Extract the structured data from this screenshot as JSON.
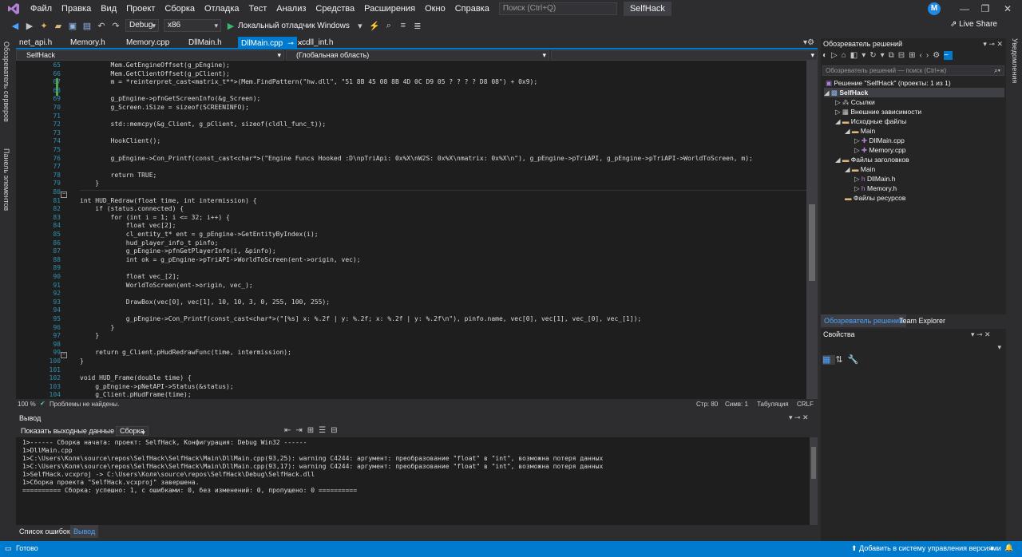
{
  "menu": {
    "items": [
      "Файл",
      "Правка",
      "Вид",
      "Проект",
      "Сборка",
      "Отладка",
      "Тест",
      "Анализ",
      "Средства",
      "Расширения",
      "Окно",
      "Справка"
    ],
    "search_placeholder": "Поиск (Ctrl+Q)",
    "solution_title": "SelfHack",
    "avatar_letter": "M",
    "live_share": "Live Share"
  },
  "toolbar": {
    "config": "Debug",
    "platform": "x86",
    "run_label": "Локальный отладчик Windows"
  },
  "left_vtabs": [
    "Обозреватель серверов",
    "Панель элементов"
  ],
  "tabs": [
    {
      "label": "net_api.h"
    },
    {
      "label": "Memory.h"
    },
    {
      "label": "Memory.cpp"
    },
    {
      "label": "DllMain.h"
    },
    {
      "label": "DllMain.cpp"
    },
    {
      "label": "cdll_int.h"
    }
  ],
  "navbar": {
    "project": "SelfHack",
    "scope": "(Глобальная область)"
  },
  "code_lines": [
    {
      "n": "65",
      "t": "        Mem.GetEngineOffset(g_pEngine);"
    },
    {
      "n": "66",
      "t": "        Mem.GetClientOffset(g_pClient);"
    },
    {
      "n": "67",
      "t": "        m = *reinterpret_cast<matrix_t**>(Mem.FindPattern(\"hw.dll\", \"51 8B 45 08 8B 4D 0C D9 05 ? ? ? ? D8 08\") + 0x9);"
    },
    {
      "n": "68",
      "t": ""
    },
    {
      "n": "69",
      "t": "        g_pEngine->pfnGetScreenInfo(&g_Screen);"
    },
    {
      "n": "70",
      "t": "        g_Screen.iSize = sizeof(SCREENINFO);"
    },
    {
      "n": "71",
      "t": ""
    },
    {
      "n": "72",
      "t": "        std::memcpy(&g_Client, g_pClient, sizeof(cldll_func_t));"
    },
    {
      "n": "73",
      "t": ""
    },
    {
      "n": "74",
      "t": "        HookClient();"
    },
    {
      "n": "75",
      "t": ""
    },
    {
      "n": "76",
      "t": "        g_pEngine->Con_Printf(const_cast<char*>(\"Engine Funcs Hooked :D\\npTriApi: 0x%X\\nW2S: 0x%X\\nmatrix: 0x%X\\n\"), g_pEngine->pTriAPI, g_pEngine->pTriAPI->WorldToScreen, m);"
    },
    {
      "n": "77",
      "t": ""
    },
    {
      "n": "78",
      "t": "        return TRUE;"
    },
    {
      "n": "79",
      "t": "    }"
    },
    {
      "n": "80",
      "t": ""
    },
    {
      "n": "81",
      "t": "int HUD_Redraw(float time, int intermission) {"
    },
    {
      "n": "82",
      "t": "    if (status.connected) {"
    },
    {
      "n": "83",
      "t": "        for (int i = 1; i <= 32; i++) {"
    },
    {
      "n": "84",
      "t": "            float vec[2];"
    },
    {
      "n": "85",
      "t": "            cl_entity_t* ent = g_pEngine->GetEntityByIndex(i);"
    },
    {
      "n": "86",
      "t": "            hud_player_info_t pinfo;"
    },
    {
      "n": "87",
      "t": "            g_pEngine->pfnGetPlayerInfo(i, &pinfo);"
    },
    {
      "n": "88",
      "t": "            int ok = g_pEngine->pTriAPI->WorldToScreen(ent->origin, vec);"
    },
    {
      "n": "89",
      "t": ""
    },
    {
      "n": "90",
      "t": "            float vec_[2];"
    },
    {
      "n": "91",
      "t": "            WorldToScreen(ent->origin, vec_);"
    },
    {
      "n": "92",
      "t": ""
    },
    {
      "n": "93",
      "t": "            DrawBox(vec[0], vec[1], 10, 10, 3, 0, 255, 100, 255);"
    },
    {
      "n": "94",
      "t": ""
    },
    {
      "n": "95",
      "t": "            g_pEngine->Con_Printf(const_cast<char*>(\"[%s] x: %.2f | y: %.2f; x: %.2f | y: %.2f\\n\"), pinfo.name, vec[0], vec[1], vec_[0], vec_[1]);"
    },
    {
      "n": "96",
      "t": "        }"
    },
    {
      "n": "97",
      "t": "    }"
    },
    {
      "n": "98",
      "t": ""
    },
    {
      "n": "99",
      "t": "    return g_Client.pHudRedrawFunc(time, intermission);"
    },
    {
      "n": "100",
      "t": "}"
    },
    {
      "n": "101",
      "t": ""
    },
    {
      "n": "102",
      "t": "void HUD_Frame(double time) {"
    },
    {
      "n": "103",
      "t": "    g_pEngine->pNetAPI->Status(&status);"
    },
    {
      "n": "104",
      "t": "    g_Client.pHudFrame(time);"
    }
  ],
  "editor_status": {
    "zoom": "100 %",
    "issues": "Проблемы не найдены.",
    "line": "Стр: 80",
    "col": "Симв: 1",
    "tabs": "Табуляция",
    "eol": "CRLF"
  },
  "output": {
    "title": "Вывод",
    "show_from_label": "Показать выходные данные из:",
    "source": "Сборка",
    "lines": [
      "1>------ Сборка начата: проект: SelfHack, Конфигурация: Debug Win32 ------",
      "1>DllMain.cpp",
      "1>C:\\Users\\Коля\\source\\repos\\SelfHack\\SelfHack\\Main\\DllMain.cpp(93,25): warning C4244: аргумент: преобразование \"float\" в \"int\", возможна потеря данных",
      "1>C:\\Users\\Коля\\source\\repos\\SelfHack\\SelfHack\\Main\\DllMain.cpp(93,17): warning C4244: аргумент: преобразование \"float\" в \"int\", возможна потеря данных",
      "1>SelfHack.vcxproj -> C:\\Users\\Коля\\source\\repos\\SelfHack\\Debug\\SelfHack.dll",
      "1>Сборка проекта \"SelfHack.vcxproj\" завершена.",
      "========== Сборка: успешно: 1, с ошибками: 0, без изменений: 0, пропущено: 0 =========="
    ]
  },
  "bottom_tabs": [
    "Список ошибок",
    "Вывод"
  ],
  "status": {
    "ready": "Готово",
    "vcs": "Добавить в систему управления версиями"
  },
  "solution_explorer": {
    "title": "Обозреватель решений",
    "search_placeholder": "Обозреватель решений — поиск (Ctrl+ж)",
    "solution": "Решение \"SelfHack\" (проекты: 1 из 1)",
    "project": "SelfHack",
    "references": "Ссылки",
    "external": "Внешние зависимости",
    "sources": "Исходные файлы",
    "main1": "Main",
    "file1": "DllMain.cpp",
    "file2": "Memory.cpp",
    "headers": "Файлы заголовков",
    "main2": "Main",
    "file3": "DllMain.h",
    "file4": "Memory.h",
    "resources": "Файлы ресурсов",
    "tab1": "Обозреватель решений",
    "tab2": "Team Explorer"
  },
  "properties": {
    "title": "Свойства"
  },
  "right_vtab": "Уведомления",
  "colors": {
    "accent": "#007acc",
    "editor_bg": "#1e1e1e",
    "chrome": "#2d2d30"
  }
}
